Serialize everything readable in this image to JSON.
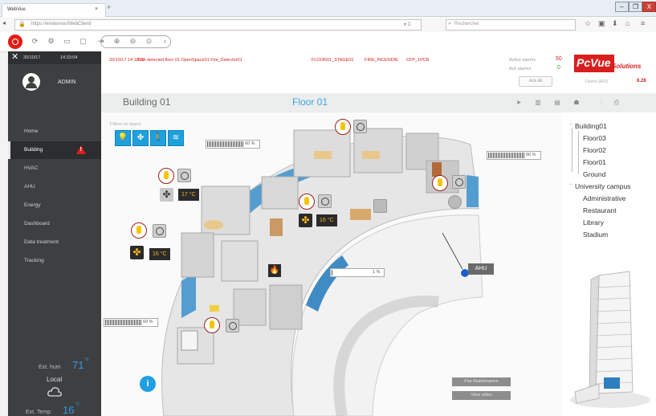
{
  "browser": {
    "tab_title": "WebVue",
    "tab_close": "×",
    "new_tab": "+",
    "url": "https://eindemos/WebClient/",
    "reload": "▾ C",
    "search_placeholder": "Rechercher",
    "window": {
      "minimize": "–",
      "maximize": "❐",
      "close": "X"
    }
  },
  "sidebar": {
    "date": "20/10/17",
    "time": "14:33:04",
    "user": "ADMIN",
    "items": [
      {
        "label": "Home"
      },
      {
        "label": "Building",
        "alert": "!"
      },
      {
        "label": "HVAC"
      },
      {
        "label": "AHU"
      },
      {
        "label": "Energy"
      },
      {
        "label": "Dashboard"
      },
      {
        "label": "Data treatment"
      },
      {
        "label": "Tracking"
      }
    ],
    "ext_hum_label": "Ext. hum",
    "ext_hum_value": "71",
    "ext_hum_unit": "%",
    "local_label": "Local",
    "ext_temp_label": "Ext. Temp",
    "ext_temp_value": "16",
    "ext_temp_unit": "°C"
  },
  "alarm": {
    "time": "20/10/17  14:18:22",
    "message": "Fire detected floor 01 OpenSpace01 Fire_Detector01",
    "location": "FLOOR01_STAGE01",
    "type": "FIRE_INCENDIE",
    "code": "CFP_1PCB",
    "active_label": "Active alarms",
    "active_value": "50",
    "ack_label": "Ack alarms",
    "ack_value": "0",
    "ack_all": "Ack All"
  },
  "brand": {
    "logo": "PcVue",
    "suffix": "Solutions",
    "demo_label": "Demo (RO)",
    "demo_value": "6.28"
  },
  "header": {
    "building": "Building 01",
    "floor": "Floor 01"
  },
  "plan": {
    "filters_label": "Filters on layers",
    "bars": [
      {
        "label": "60 %",
        "level": 60
      },
      {
        "label": "60 %",
        "level": 60
      },
      {
        "label": "1 %",
        "level": 1
      },
      {
        "label": "60 %",
        "level": 60
      }
    ],
    "temps": [
      "17 °C",
      "16 °C",
      "16 °C"
    ],
    "ahu": "AHU",
    "info": "i",
    "buttons": [
      "Fire Maintenance",
      "View video"
    ]
  },
  "tree": {
    "root1": "Building01",
    "floors": [
      "Floor03",
      "Floor02",
      "Floor01",
      "Ground"
    ],
    "root2": "University campus",
    "campus": [
      "Administrative",
      "Restaurant",
      "Library",
      "Stadium"
    ]
  },
  "colors": {
    "accent": "#1fa0dd",
    "alarm": "#d42222",
    "sidebar": "#3e3f41",
    "brand": "#d81e1e"
  }
}
